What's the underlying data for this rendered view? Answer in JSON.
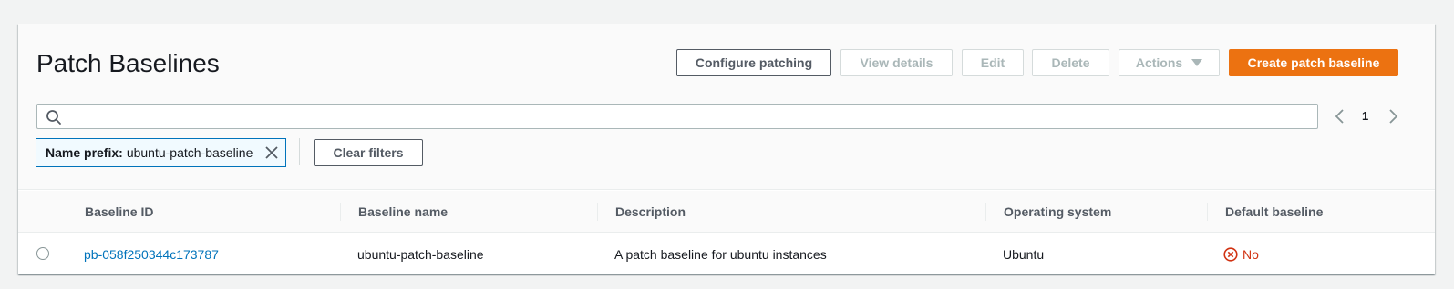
{
  "page": {
    "title": "Patch Baselines"
  },
  "toolbar": {
    "configure_label": "Configure patching",
    "view_details_label": "View details",
    "edit_label": "Edit",
    "delete_label": "Delete",
    "actions_label": "Actions",
    "create_label": "Create patch baseline"
  },
  "search": {
    "value": "",
    "placeholder": ""
  },
  "pagination": {
    "current_page": "1"
  },
  "filter": {
    "label": "Name prefix:",
    "value": "ubuntu-patch-baseline",
    "clear_label": "Clear filters"
  },
  "table": {
    "columns": [
      "Baseline ID",
      "Baseline name",
      "Description",
      "Operating system",
      "Default baseline"
    ],
    "rows": [
      {
        "baseline_id": "pb-058f250344c173787",
        "baseline_name": "ubuntu-patch-baseline",
        "description": "A patch baseline for ubuntu instances",
        "operating_system": "Ubuntu",
        "default_baseline": "No"
      }
    ]
  },
  "colors": {
    "primary": "#ec7211",
    "link": "#0073bb",
    "error": "#d13212",
    "background": "#f2f3f3"
  },
  "icons": {
    "search": "search-icon",
    "close": "close-icon",
    "prev": "chevron-left-icon",
    "next": "chevron-right-icon",
    "status": "x-circle-icon",
    "dropdown": "caret-down-icon"
  }
}
